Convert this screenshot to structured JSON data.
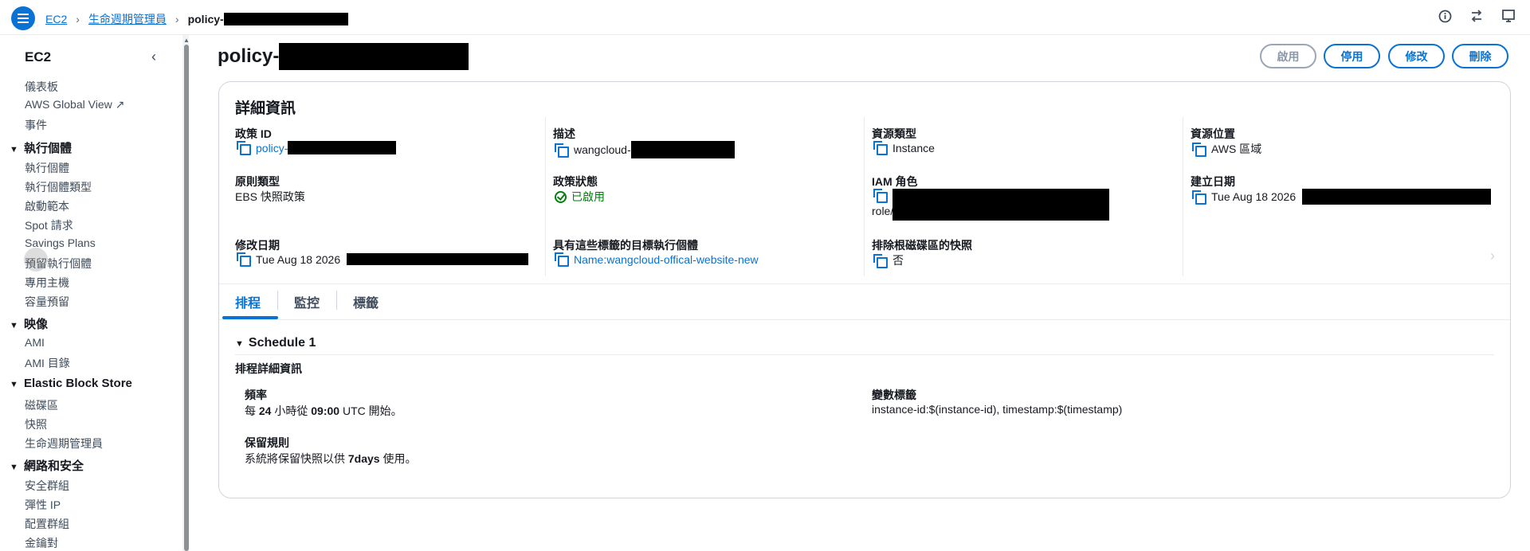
{
  "breadcrumb": {
    "items": [
      "EC2",
      "生命週期管理員"
    ],
    "current": "policy-"
  },
  "sidebar": {
    "title": "EC2",
    "top_links": [
      "儀表板",
      "AWS Global View",
      "事件"
    ],
    "sections": [
      {
        "label": "執行個體",
        "items": [
          "執行個體",
          "執行個體類型",
          "啟動範本",
          "Spot 請求",
          "Savings Plans",
          "預留執行個體",
          "專用主機",
          "容量預留"
        ]
      },
      {
        "label": "映像",
        "items": [
          "AMI",
          "AMI 目錄"
        ]
      },
      {
        "label": "Elastic Block Store",
        "items": [
          "磁碟區",
          "快照",
          "生命週期管理員"
        ]
      },
      {
        "label": "網路和安全",
        "items": [
          "安全群組",
          "彈性 IP",
          "配置群組",
          "金鑰對"
        ]
      }
    ]
  },
  "page": {
    "title": "policy-",
    "buttons": {
      "enable": "啟用",
      "disable": "停用",
      "modify": "修改",
      "delete": "刪除"
    }
  },
  "details": {
    "title": "詳細資訊",
    "policy_id": {
      "label": "政策 ID",
      "value": "policy-"
    },
    "description": {
      "label": "描述",
      "value": "wangcloud-"
    },
    "resource_type": {
      "label": "資源類型",
      "value": "Instance"
    },
    "resource_location": {
      "label": "資源位置",
      "value": "AWS 區域"
    },
    "policy_type": {
      "label": "原則類型",
      "value": "EBS 快照政策"
    },
    "policy_status": {
      "label": "政策狀態",
      "value": "已啟用"
    },
    "iam_role": {
      "label": "IAM 角色",
      "value": "role/"
    },
    "created_date": {
      "label": "建立日期",
      "value": "Tue Aug 18 2026"
    },
    "modified_date": {
      "label": "修改日期",
      "value": "Tue Aug 18 2026"
    },
    "target_tags": {
      "label": "具有這些標籤的目標執行個體",
      "value": "Name:wangcloud-offical-website-new"
    },
    "exclude_root": {
      "label": "排除根磁碟區的快照",
      "value": "否"
    }
  },
  "tabs": [
    "排程",
    "監控",
    "標籤"
  ],
  "schedule": {
    "title": "Schedule 1",
    "section": "排程詳細資訊",
    "frequency": {
      "label": "頻率",
      "prefix": "每",
      "hours": "24",
      "mid": "小時從",
      "time": "09:00",
      "suffix": "UTC 開始。"
    },
    "variable_tags": {
      "label": "變數標籤",
      "value": "instance-id:$(instance-id), timestamp:$(timestamp)"
    },
    "retention": {
      "label": "保留規則",
      "prefix": "系統將保留快照以供",
      "days": "7days",
      "suffix": "使用。"
    }
  },
  "colors": {
    "accent": "#0972d3",
    "success": "#037f0c"
  }
}
